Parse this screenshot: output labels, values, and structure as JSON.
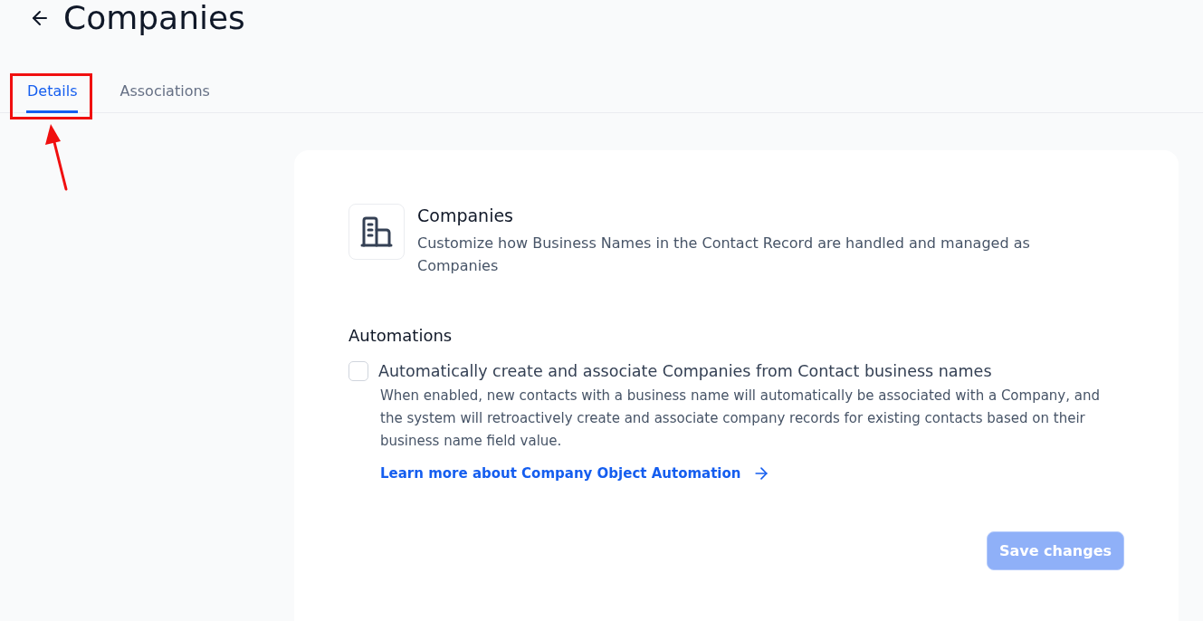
{
  "header": {
    "title": "Companies"
  },
  "tabs": [
    {
      "label": "Details",
      "selected": true,
      "highlighted": true
    },
    {
      "label": "Associations",
      "selected": false,
      "highlighted": false
    }
  ],
  "card": {
    "title": "Companies",
    "description": "Customize how Business Names in the Contact Record are handled and managed as Companies"
  },
  "automations": {
    "heading": "Automations",
    "options": [
      {
        "label": "Automatically create and associate Companies from Contact business names",
        "checked": false,
        "help": "When enabled, new contacts with a business name will automatically be associated with a Company, and the system will retroactively create and associate company records for existing contacts based on their business name field value.",
        "link": "Learn more about Company Object Automation"
      }
    ]
  },
  "save_button": {
    "label": "Save changes",
    "disabled": true
  }
}
